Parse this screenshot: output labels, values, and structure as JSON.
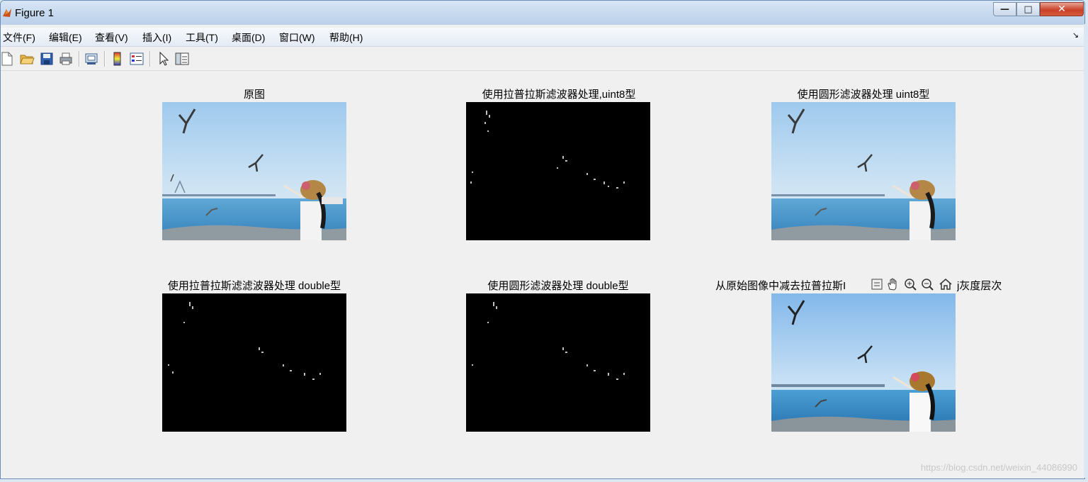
{
  "window": {
    "title": "Figure 1"
  },
  "menu": [
    {
      "label": "文件(F)"
    },
    {
      "label": "编辑(E)"
    },
    {
      "label": "查看(V)"
    },
    {
      "label": "插入(I)"
    },
    {
      "label": "工具(T)"
    },
    {
      "label": "桌面(D)"
    },
    {
      "label": "窗口(W)"
    },
    {
      "label": "帮助(H)"
    }
  ],
  "toolbar": [
    "new-figure-icon",
    "open-folder-icon",
    "save-icon",
    "print-icon",
    "print-preview-icon",
    "colorbar-icon",
    "legend-icon",
    "pointer-icon",
    "property-editor-icon"
  ],
  "plots": [
    {
      "title": "原图"
    },
    {
      "title": "使用拉普拉斯滤波器处理,uint8型"
    },
    {
      "title": "使用圆形滤波器处理   uint8型"
    },
    {
      "title": "使用拉普拉斯滤滤波器处理   double型"
    },
    {
      "title": "使用圆形滤波器处理   double型"
    },
    {
      "title_left": "从原始图像中减去拉普拉斯I",
      "title_right": "j灰度层次"
    }
  ],
  "figure_toolbar": [
    "brush-icon",
    "pan-hand-icon",
    "zoom-in-icon",
    "zoom-out-icon",
    "home-icon"
  ],
  "watermark": "https://blog.csdn.net/weixin_44086990",
  "colors": {
    "accent": "#1f5fa8",
    "image_black": "#000000"
  }
}
